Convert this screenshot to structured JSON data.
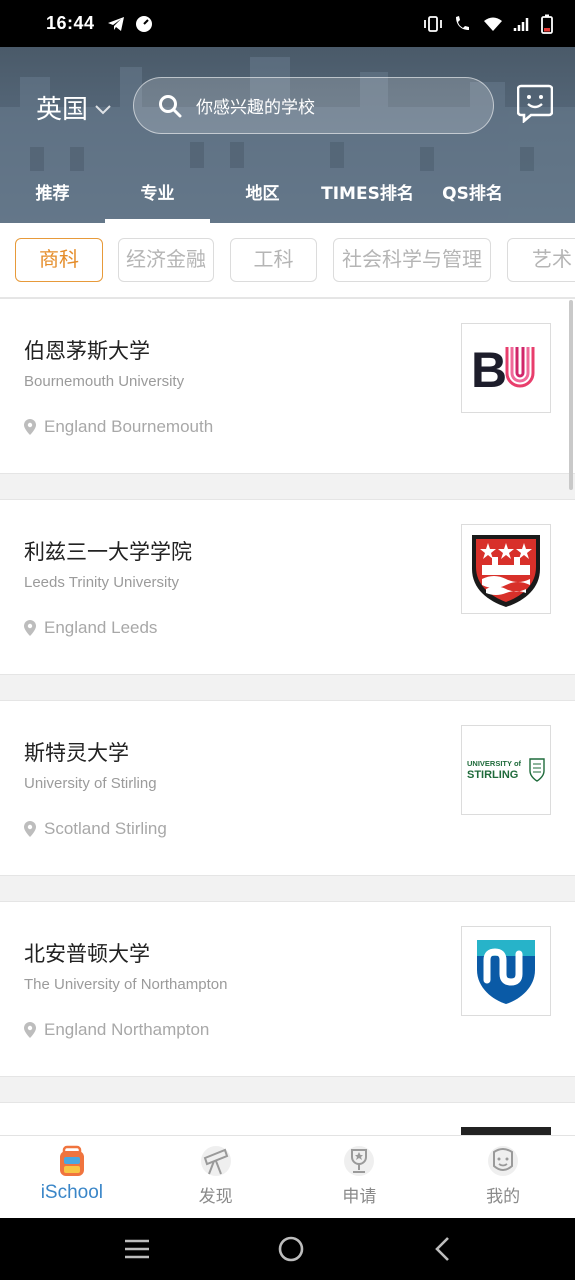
{
  "status_bar": {
    "time": "16:44"
  },
  "header": {
    "country": "英国",
    "search_placeholder": "你感兴趣的学校",
    "tabs": [
      {
        "label": "推荐",
        "active": false
      },
      {
        "label": "专业",
        "active": true
      },
      {
        "label": "地区",
        "active": false
      },
      {
        "label": "TIMES排名",
        "active": false
      },
      {
        "label": "QS排名",
        "active": false
      }
    ]
  },
  "chips": [
    {
      "label": "商科",
      "active": true
    },
    {
      "label": "经济金融",
      "active": false
    },
    {
      "label": "工科",
      "active": false
    },
    {
      "label": "社会科学与管理",
      "active": false
    },
    {
      "label": "艺术",
      "active": false
    }
  ],
  "schools": [
    {
      "name": "伯恩茅斯大学",
      "name_en": "Bournemouth University",
      "location": "England Bournemouth",
      "logo_icon": "bu-logo"
    },
    {
      "name": "利兹三一大学学院",
      "name_en": "Leeds Trinity University",
      "location": "England Leeds",
      "logo_icon": "leeds-trinity-crest"
    },
    {
      "name": "斯特灵大学",
      "name_en": "University of Stirling",
      "location": "Scotland Stirling",
      "logo_icon": "stirling-logo",
      "logo_text_top": "UNIVERSITY of",
      "logo_text_bottom": "STIRLING"
    },
    {
      "name": "北安普顿大学",
      "name_en": "The University of Northampton",
      "location": "England Northampton",
      "logo_icon": "northampton-logo"
    }
  ],
  "logos": {
    "bu_letters_b": "B",
    "bu_letters_u": "U"
  },
  "bottom_nav": [
    {
      "label": "iSchool",
      "icon": "backpack-icon",
      "active": true
    },
    {
      "label": "发现",
      "icon": "telescope-icon",
      "active": false
    },
    {
      "label": "申请",
      "icon": "trophy-icon",
      "active": false
    },
    {
      "label": "我的",
      "icon": "profile-icon",
      "active": false
    }
  ],
  "colors": {
    "accent_orange": "#e58d2a",
    "active_blue": "#3a86c8"
  }
}
